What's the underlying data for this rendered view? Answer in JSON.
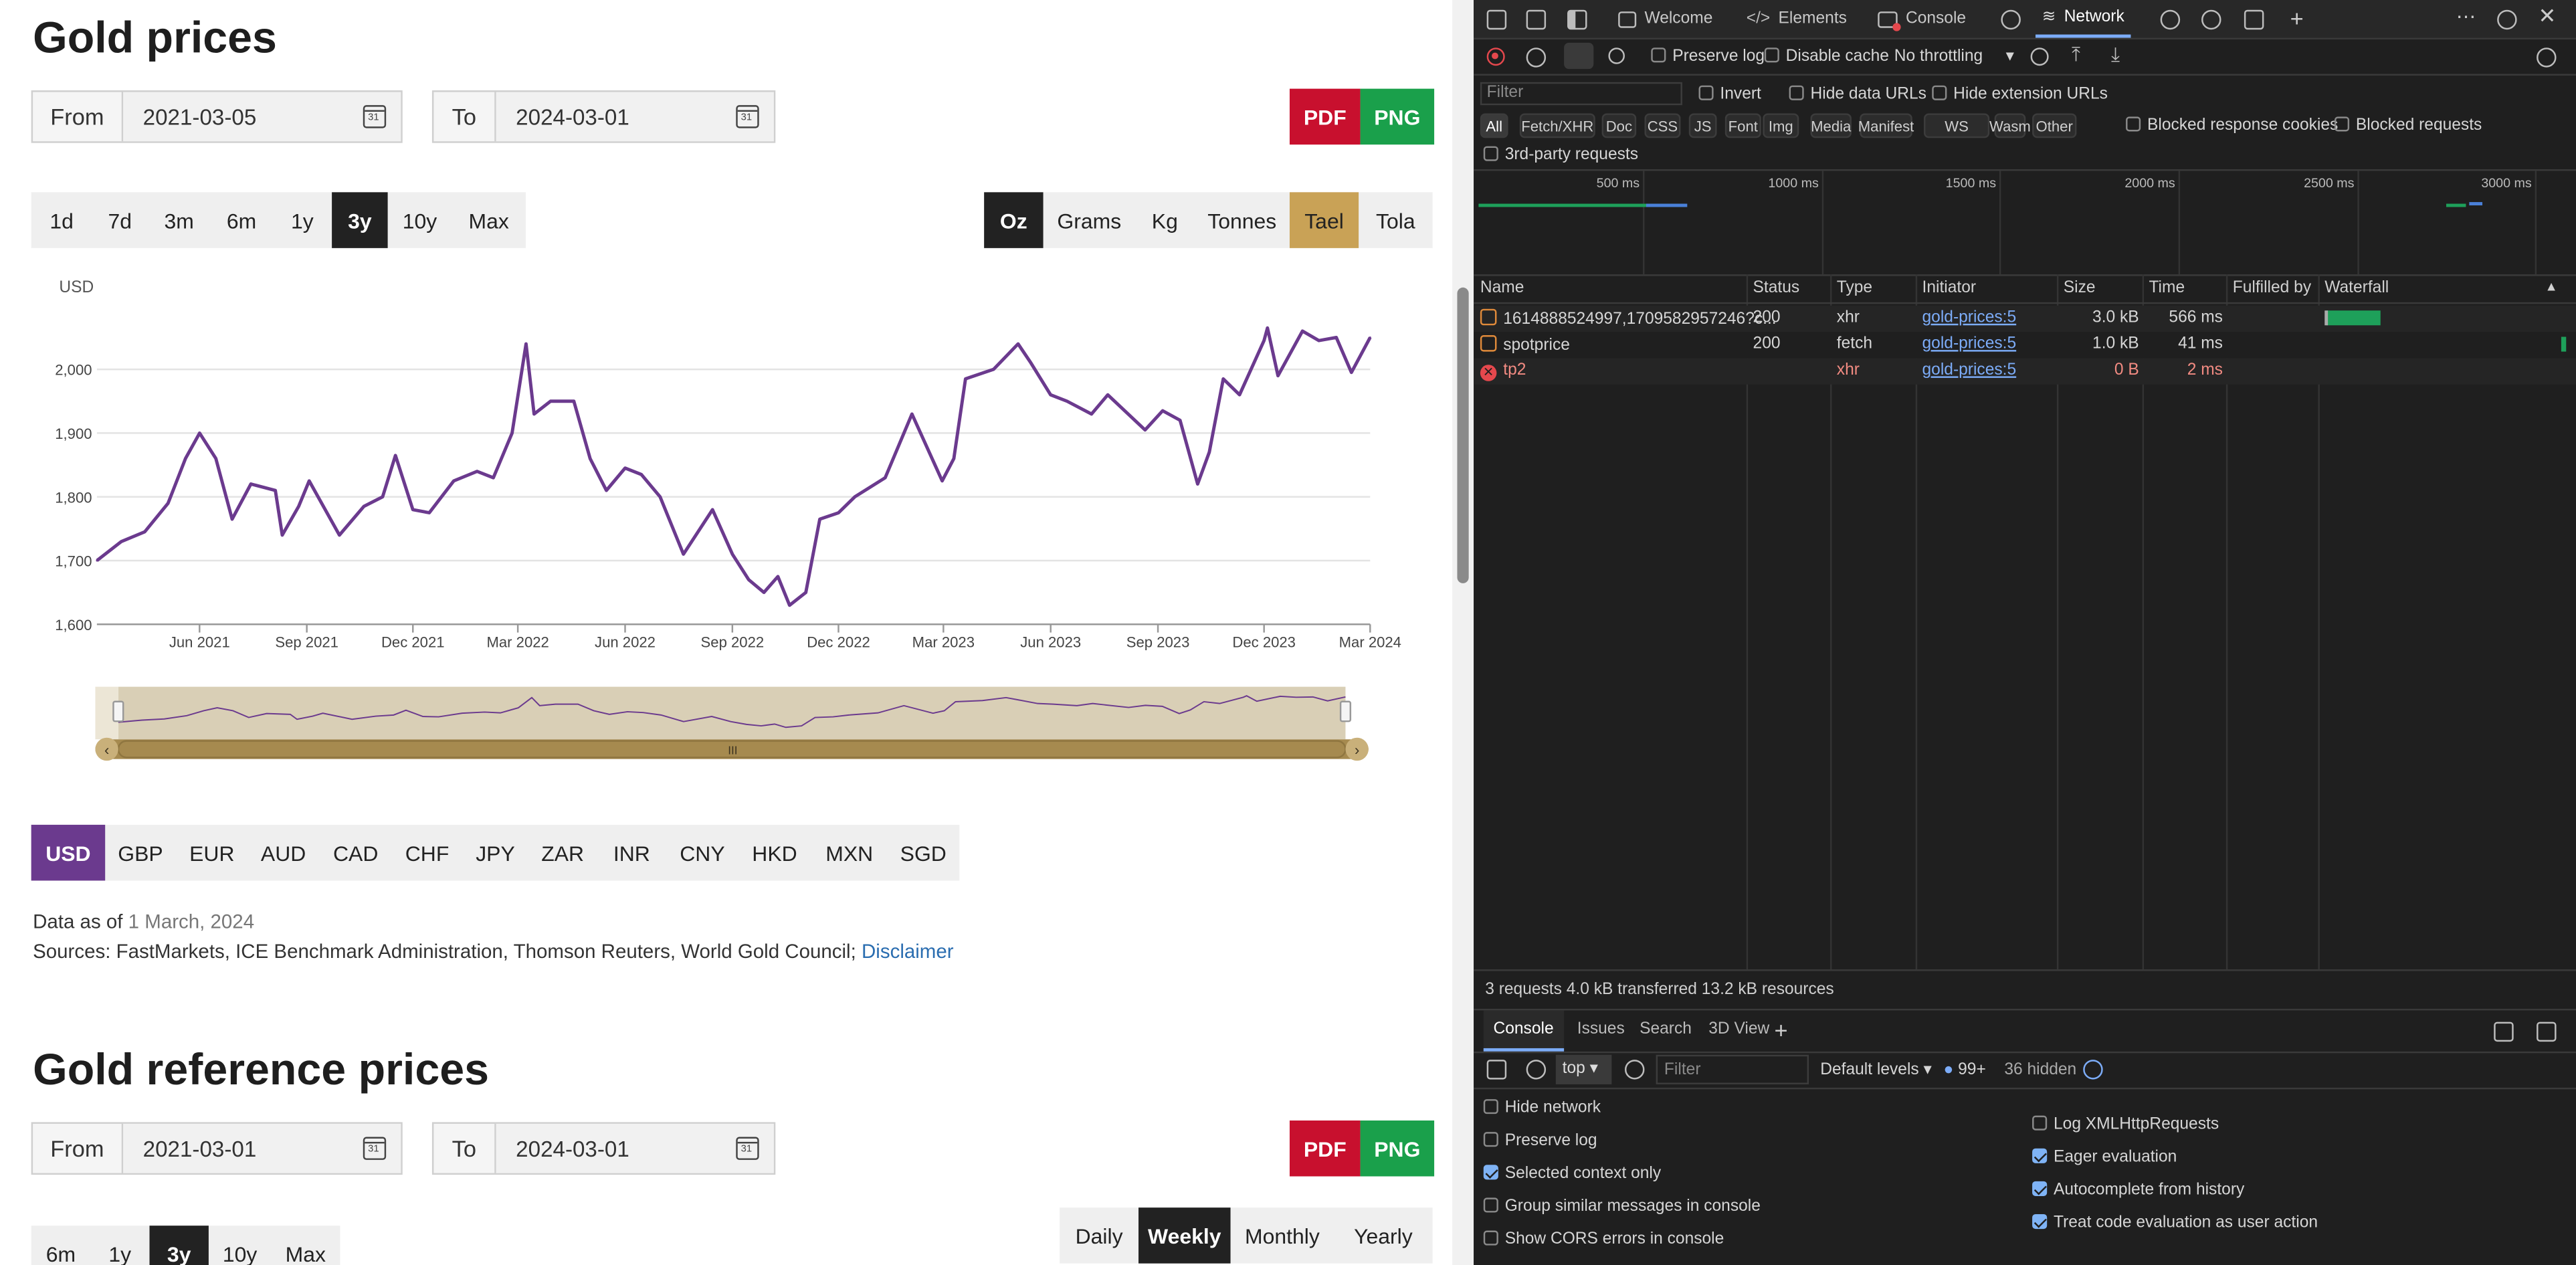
{
  "page": {
    "title": "Gold prices",
    "from_label": "From",
    "to_label": "To",
    "from_date": "2021-03-05",
    "to_date": "2024-03-01",
    "cal_day": "31",
    "pdf": "PDF",
    "png": "PNG",
    "ranges": [
      "1d",
      "7d",
      "3m",
      "6m",
      "1y",
      "3y",
      "10y",
      "Max"
    ],
    "range_active": "3y",
    "units": [
      "Oz",
      "Grams",
      "Kg",
      "Tonnes",
      "Tael",
      "Tola"
    ],
    "unit_active": "Oz",
    "currencies": [
      "USD",
      "GBP",
      "EUR",
      "AUD",
      "CAD",
      "CHF",
      "JPY",
      "ZAR",
      "INR",
      "CNY",
      "HKD",
      "MXN",
      "SGD"
    ],
    "currency_active": "USD",
    "data_as_of_label": "Data as of",
    "data_as_of_date": "1 March, 2024",
    "sources_text": "Sources: FastMarkets, ICE Benchmark Administration, Thomson Reuters, World Gold Council;",
    "disclaimer": "Disclaimer",
    "ref_title": "Gold reference prices",
    "ref_from_date": "2021-03-01",
    "ref_to_date": "2024-03-01",
    "ref_ranges": [
      "6m",
      "1y",
      "3y",
      "10y",
      "Max"
    ],
    "ref_range_active": "3y",
    "frequencies": [
      "Daily",
      "Weekly",
      "Monthly",
      "Yearly"
    ],
    "frequency_active": "Weekly",
    "navigator_grip": "III"
  },
  "chart_data": {
    "type": "line",
    "ylabel": "USD",
    "ylim": [
      1600,
      2100
    ],
    "yticks": [
      "1,600",
      "1,700",
      "1,800",
      "1,900",
      "2,000"
    ],
    "ytick_values": [
      1600,
      1700,
      1800,
      1900,
      2000
    ],
    "xticks": [
      "Jun 2021",
      "Sep 2021",
      "Dec 2021",
      "Mar 2022",
      "Jun 2022",
      "Sep 2022",
      "Dec 2022",
      "Mar 2023",
      "Jun 2023",
      "Sep 2023",
      "Dec 2023",
      "Mar 2024"
    ],
    "xtick_dates": [
      "2021-06-01",
      "2021-09-01",
      "2021-12-01",
      "2022-03-01",
      "2022-06-01",
      "2022-09-01",
      "2022-12-01",
      "2023-03-01",
      "2023-06-01",
      "2023-09-01",
      "2023-12-01",
      "2024-03-01"
    ],
    "x_range": [
      "2021-03-05",
      "2024-03-01"
    ],
    "color": "#6b3a8e",
    "series": [
      {
        "x": [
          "2021-03-05",
          "2021-03-26",
          "2021-04-15",
          "2021-05-05",
          "2021-05-20",
          "2021-06-01",
          "2021-06-15",
          "2021-06-29",
          "2021-07-15",
          "2021-08-05",
          "2021-08-11",
          "2021-08-25",
          "2021-09-03",
          "2021-09-29",
          "2021-10-20",
          "2021-11-05",
          "2021-11-16",
          "2021-12-01",
          "2021-12-15",
          "2022-01-05",
          "2022-01-25",
          "2022-02-08",
          "2022-02-24",
          "2022-03-08",
          "2022-03-15",
          "2022-03-29",
          "2022-04-18",
          "2022-05-02",
          "2022-05-16",
          "2022-06-01",
          "2022-06-15",
          "2022-07-01",
          "2022-07-21",
          "2022-08-15",
          "2022-09-01",
          "2022-09-15",
          "2022-09-28",
          "2022-10-10",
          "2022-10-20",
          "2022-11-03",
          "2022-11-15",
          "2022-12-01",
          "2022-12-15",
          "2023-01-10",
          "2023-02-02",
          "2023-02-28",
          "2023-03-10",
          "2023-03-20",
          "2023-04-13",
          "2023-05-04",
          "2023-05-15",
          "2023-06-01",
          "2023-06-15",
          "2023-07-06",
          "2023-07-20",
          "2023-08-21",
          "2023-09-05",
          "2023-09-20",
          "2023-10-05",
          "2023-10-15",
          "2023-10-27",
          "2023-11-10",
          "2023-12-01",
          "2023-12-04",
          "2023-12-13",
          "2024-01-03",
          "2024-01-17",
          "2024-02-01",
          "2024-02-14",
          "2024-03-01"
        ],
        "y": [
          1700,
          1730,
          1745,
          1790,
          1860,
          1900,
          1860,
          1765,
          1820,
          1810,
          1740,
          1785,
          1825,
          1740,
          1785,
          1800,
          1865,
          1780,
          1775,
          1825,
          1840,
          1830,
          1900,
          2040,
          1930,
          1950,
          1950,
          1860,
          1810,
          1845,
          1835,
          1800,
          1710,
          1780,
          1710,
          1670,
          1650,
          1675,
          1630,
          1650,
          1765,
          1775,
          1800,
          1830,
          1930,
          1825,
          1860,
          1985,
          2000,
          2040,
          2010,
          1960,
          1950,
          1930,
          1960,
          1905,
          1935,
          1920,
          1820,
          1870,
          1985,
          1960,
          2045,
          2065,
          1990,
          2060,
          2045,
          2050,
          1995,
          2050
        ]
      }
    ],
    "navigator": {
      "start": "2021-03-05",
      "end": "2024-03-01"
    }
  },
  "devtools": {
    "tabs": [
      "Welcome",
      "Elements",
      "Console",
      "Network"
    ],
    "active_tab": "Network",
    "toolbar": {
      "preserve_log": "Preserve log",
      "disable_cache": "Disable cache",
      "throttling": "No throttling"
    },
    "filter_placeholder": "Filter",
    "invert": "Invert",
    "hide_data_urls": "Hide data URLs",
    "hide_extension_urls": "Hide extension URLs",
    "type_filters": [
      "All",
      "Fetch/XHR",
      "Doc",
      "CSS",
      "JS",
      "Font",
      "Img",
      "Media",
      "Manifest",
      "WS",
      "Wasm",
      "Other"
    ],
    "blocked_cookies": "Blocked response cookies",
    "blocked_requests": "Blocked requests",
    "third_party": "3rd-party requests",
    "timeline_ticks": [
      "500 ms",
      "1000 ms",
      "1500 ms",
      "2000 ms",
      "2500 ms",
      "3000 ms"
    ],
    "columns": [
      "Name",
      "Status",
      "Type",
      "Initiator",
      "Size",
      "Time",
      "Fulfilled by",
      "Waterfall"
    ],
    "rows": [
      {
        "name": "1614888524997,1709582957246?c...",
        "status": "200",
        "type": "xhr",
        "initiator": "gold-prices:5",
        "size": "3.0 kB",
        "time": "566 ms",
        "error": false
      },
      {
        "name": "spotprice",
        "status": "200",
        "type": "fetch",
        "initiator": "gold-prices:5",
        "size": "1.0 kB",
        "time": "41 ms",
        "error": false
      },
      {
        "name": "tp2",
        "status": "",
        "type": "xhr",
        "initiator": "gold-prices:5",
        "size": "0 B",
        "time": "2 ms",
        "error": true
      }
    ],
    "summary": "3 requests  4.0 kB transferred  13.2 kB resources",
    "drawer_tabs": [
      "Console",
      "Issues",
      "Search",
      "3D View"
    ],
    "drawer_active": "Console",
    "context": "top",
    "console_filter_placeholder": "Filter",
    "default_levels": "Default levels",
    "message_count": "99+",
    "hidden_count": "36 hidden",
    "settings_left": [
      {
        "label": "Hide network",
        "checked": false
      },
      {
        "label": "Preserve log",
        "checked": false
      },
      {
        "label": "Selected context only",
        "checked": true
      },
      {
        "label": "Group similar messages in console",
        "checked": false
      },
      {
        "label": "Show CORS errors in console",
        "checked": false
      }
    ],
    "settings_right": [
      {
        "label": "Log XMLHttpRequests",
        "checked": false
      },
      {
        "label": "Eager evaluation",
        "checked": true
      },
      {
        "label": "Autocomplete from history",
        "checked": true
      },
      {
        "label": "Treat code evaluation as user action",
        "checked": true
      }
    ]
  },
  "colors": {
    "line": "#6b3a8e",
    "pdf": "#c8102e",
    "png": "#1aa04b",
    "tael": "#c9a256",
    "devtools_bg": "#1f1f1f"
  }
}
